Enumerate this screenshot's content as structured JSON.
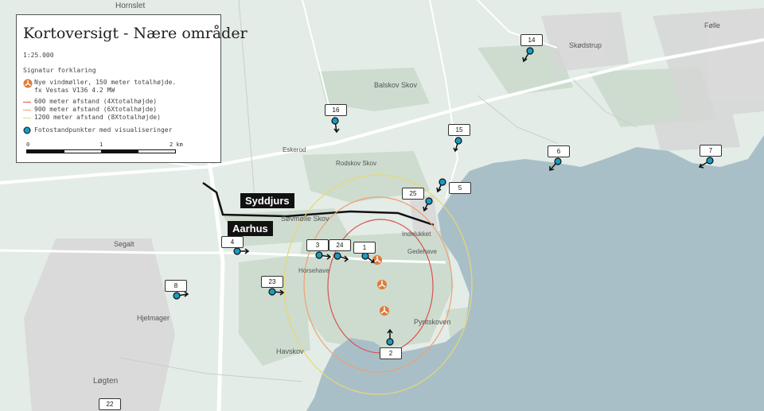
{
  "legend": {
    "title": "Kortoversigt - Nære områder",
    "scale": "1:25.000",
    "heading": "Signatur forklaring",
    "turbine_line1": "Nye vindmøller, 150 meter totalhøjde.",
    "turbine_line2": "fx Vestas V136 4.2 MW",
    "dist_600": "600 meter afstand (4Xtotalhøjde)",
    "dist_900": "900 meter afstand (6Xtotalhøjde)",
    "dist_1200": "1200 meter afstand (8Xtotalhøjde)",
    "photo_points": "Fotostandpunkter med visualiseringer",
    "scalebar": {
      "t0": "0",
      "t1": "1",
      "t2": "2 km"
    }
  },
  "regions": {
    "north": "Syddjurs",
    "south": "Aarhus"
  },
  "place_names": [
    "Hornslet",
    "Balskov Skov",
    "Rodskov Skov",
    "Eskerod",
    "Søvmølle Skov",
    "Segalt",
    "Indelukket",
    "Gedehave",
    "Horsehave",
    "Pyntskoven",
    "Havskov",
    "Hjelmager",
    "Løgten",
    "Følle",
    "Skødstrup"
  ],
  "photo_points": [
    "1",
    "2",
    "3",
    "4",
    "5",
    "6",
    "7",
    "8",
    "14",
    "15",
    "16",
    "22",
    "23",
    "24",
    "25"
  ],
  "colors": {
    "water": "#a9bfc8",
    "land": "#e3ece6",
    "forest": "#cddccf",
    "road": "#ffffff",
    "ring_600": "#d9534f",
    "ring_900": "#f0a070",
    "ring_1200": "#e8d870",
    "turbine": "#e07b39",
    "photo_point": "#1b9bc0",
    "border": "#111111"
  }
}
